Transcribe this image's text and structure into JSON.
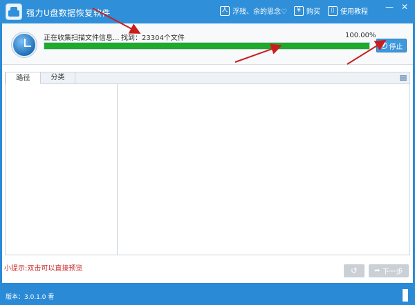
{
  "window": {
    "title": "强力U盘数据恢复软件",
    "minimize_glyph": "—",
    "close_glyph": "✕"
  },
  "header_links": [
    {
      "label": "浮残、余的思念♡",
      "icon": "user-icon",
      "glyph": "人"
    },
    {
      "label": "购买",
      "icon": "yen-icon",
      "glyph": "¥"
    },
    {
      "label": "使用教程",
      "icon": "book-icon",
      "glyph": "▯"
    }
  ],
  "scan": {
    "status": "正在收集扫描文件信息...",
    "found": "找到：23304个文件",
    "percent_text": "100.00%",
    "progress_fraction": 1.0,
    "stop_label": "停止"
  },
  "tabs": [
    {
      "label": "路径",
      "active": true
    },
    {
      "label": "分类",
      "active": false
    }
  ],
  "hint": "小提示:双击可以直接预览",
  "nav": {
    "back_glyph": "↺",
    "next_label": "下一步",
    "next_glyph": "➦"
  },
  "footer": {
    "version": "版本：3.0.1.0 看"
  },
  "colors": {
    "brand_blue": "#2f8fd8",
    "progress_green": "#1eaa2b",
    "hint_red": "#cc2b2b",
    "annotation_red": "#c81e1e"
  }
}
